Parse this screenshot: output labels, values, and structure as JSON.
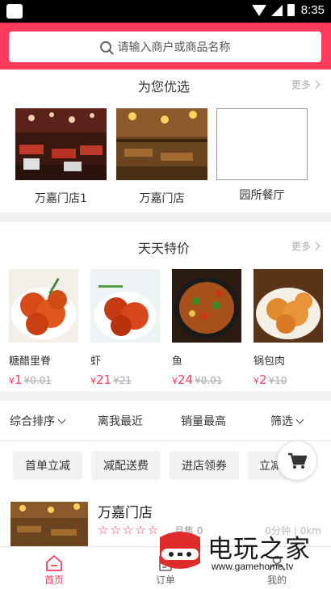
{
  "status_bar": {
    "time": "8:35"
  },
  "search": {
    "placeholder": "请输入商户或商品名称"
  },
  "recommended": {
    "title": "为您优选",
    "more": "更多",
    "shops": [
      {
        "name": "万嘉门店1"
      },
      {
        "name": "万嘉门店"
      },
      {
        "name": "园所餐厅"
      }
    ]
  },
  "daily_deals": {
    "title": "天天特价",
    "more": "更多",
    "items": [
      {
        "name": "糖醋里脊",
        "price": "1",
        "original": "0.01"
      },
      {
        "name": "虾",
        "price": "21",
        "original": "21"
      },
      {
        "name": "鱼",
        "price": "24",
        "original": "0.01"
      },
      {
        "name": "锅包肉",
        "price": "2",
        "original": "10"
      }
    ]
  },
  "currency": "¥",
  "sort": {
    "options": [
      "综合排序",
      "离我最近",
      "销量最高",
      "筛选"
    ]
  },
  "tags": [
    "首单立减",
    "减配送费",
    "进店领券",
    "立减"
  ],
  "listing": {
    "name": "万嘉门店",
    "sales": "月售 0",
    "distance": "0分钟 | 0km"
  },
  "tabbar": {
    "tabs": [
      "首页",
      "订单",
      "我的"
    ]
  },
  "watermark": {
    "name": "电玩之家",
    "url": "www.gamehome.tv"
  },
  "colors": {
    "accent": "#fc3a5c"
  }
}
